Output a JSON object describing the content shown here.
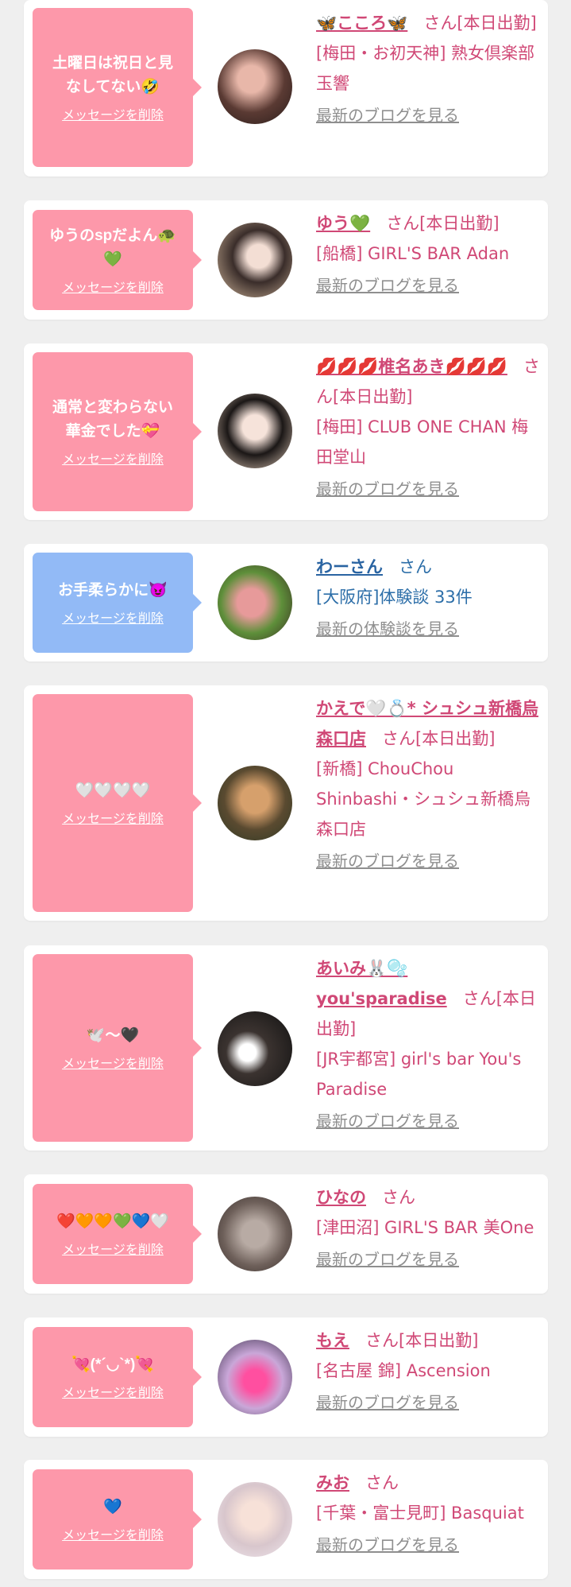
{
  "colors": {
    "bubble_pink": "#fd98aa",
    "bubble_blue": "#92baf6",
    "text_pink": "#d04876",
    "text_blue": "#2c6ea8",
    "link_gray": "#8f8f8f"
  },
  "delete_label": "メッセージを削除",
  "items": [
    {
      "message": "土曜日は祝日と見\nなしてない🤣",
      "name": "🦋こころ🦋",
      "honor": "さん[本日出勤]",
      "shop": "[梅田・お初天神] 熟女倶楽部 玉響",
      "link": "最新のブログを見る"
    },
    {
      "message": "ゆうのspだよん🐢\n💚",
      "name": "ゆう💚",
      "honor": "さん[本日出勤]",
      "shop": "[船橋] GIRL'S BAR Adan",
      "link": "最新のブログを見る"
    },
    {
      "message": "通常と変わらない\n華金でした💝",
      "name": "💋💋💋椎名あき💋💋💋",
      "honor": "さん[本日出勤]",
      "shop": "[梅田] CLUB ONE CHAN 梅田堂山",
      "link": "最新のブログを見る"
    },
    {
      "message": "お手柔らかに😈",
      "name": "わーさん",
      "honor": "さん",
      "shop": "[大阪府]体験談 33件",
      "link": "最新の体験談を見る"
    },
    {
      "message": "🤍🤍🤍🤍",
      "name": "かえで🤍💍* シュシュ新橋烏森口店",
      "honor": "さん[本日出勤]",
      "shop": "[新橋] ChouChou Shinbashi・シュシュ新橋烏森口店",
      "link": "最新のブログを見る"
    },
    {
      "message": "🕊️〜🖤",
      "name": "あいみ🐰🫧 you'sparadise",
      "honor": "さん[本日出勤]",
      "shop": "[JR宇都宮] girl's bar You's Paradise",
      "link": "最新のブログを見る"
    },
    {
      "message": "❤️🧡🧡💚💙🤍",
      "name": "ひなの",
      "honor": "さん",
      "shop": "[津田沼] GIRL'S BAR 美One",
      "link": "最新のブログを見る"
    },
    {
      "message": "💘(*´◡`*)💘",
      "name": "もえ",
      "honor": "さん[本日出勤]",
      "shop": "[名古屋 錦] Ascension",
      "link": "最新のブログを見る"
    },
    {
      "message": "💙",
      "name": "みお",
      "honor": "さん",
      "shop": "[千葉・富士見町] Basquiat",
      "link": "最新のブログを見る"
    }
  ]
}
